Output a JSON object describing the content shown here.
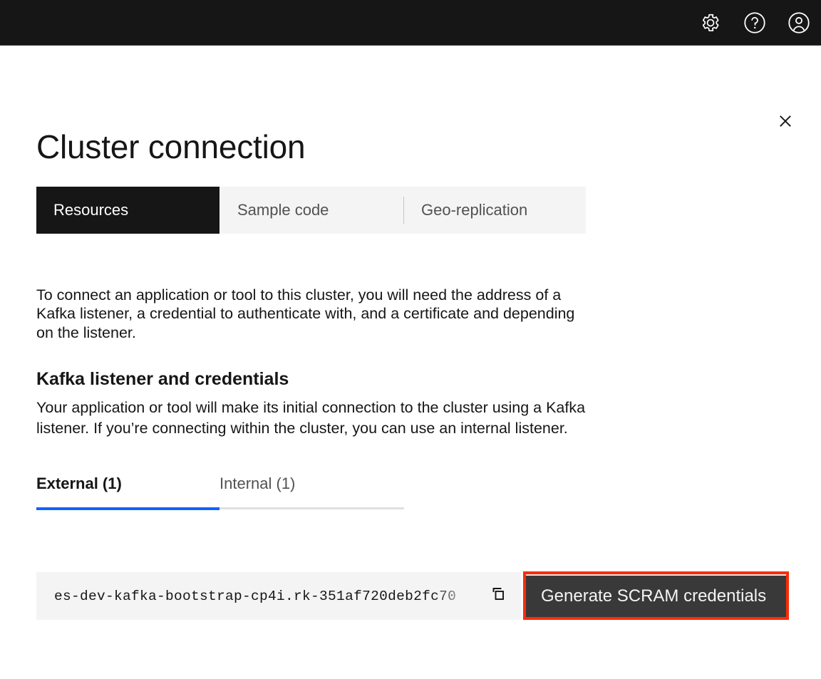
{
  "header": {
    "icons": [
      {
        "name": "settings-icon",
        "label": "Settings"
      },
      {
        "name": "help-icon",
        "label": "Help"
      },
      {
        "name": "user-avatar-icon",
        "label": "User profile"
      }
    ]
  },
  "close_button": {
    "label": "Close",
    "icon": "close-icon"
  },
  "page_title": "Cluster connection",
  "content_switcher": {
    "items": [
      {
        "label": "Resources",
        "selected": true
      },
      {
        "label": "Sample code",
        "selected": false
      },
      {
        "label": "Geo-replication",
        "selected": false
      }
    ]
  },
  "intro_paragraph": "To connect an application or tool to this cluster, you will need the address of a Kafka listener, a credential to authenticate with, and a certificate and depending on the listener.",
  "section": {
    "title": "Kafka listener and credentials",
    "body": "Your application or tool will make its initial connection to the cluster using a Kafka listener. If you’re connecting within the cluster, you can use an internal listener."
  },
  "listener_tabs": {
    "items": [
      {
        "label": "External (1)",
        "active": true
      },
      {
        "label": "Internal (1)",
        "active": false
      }
    ]
  },
  "bootstrap_address": {
    "value": "es-dev-kafka-bootstrap-cp4i.rk-351af720deb2fc70",
    "copy_icon": "copy-icon"
  },
  "scram_button": {
    "label": "Generate SCRAM credentials",
    "highlighted": true
  },
  "colors": {
    "header_background": "#161616",
    "accent_blue": "#0f62fe",
    "field_background": "#f4f4f4",
    "switcher_selected": "#161616",
    "annotation_red": "#fb2c09",
    "button_dark": "#393939"
  }
}
